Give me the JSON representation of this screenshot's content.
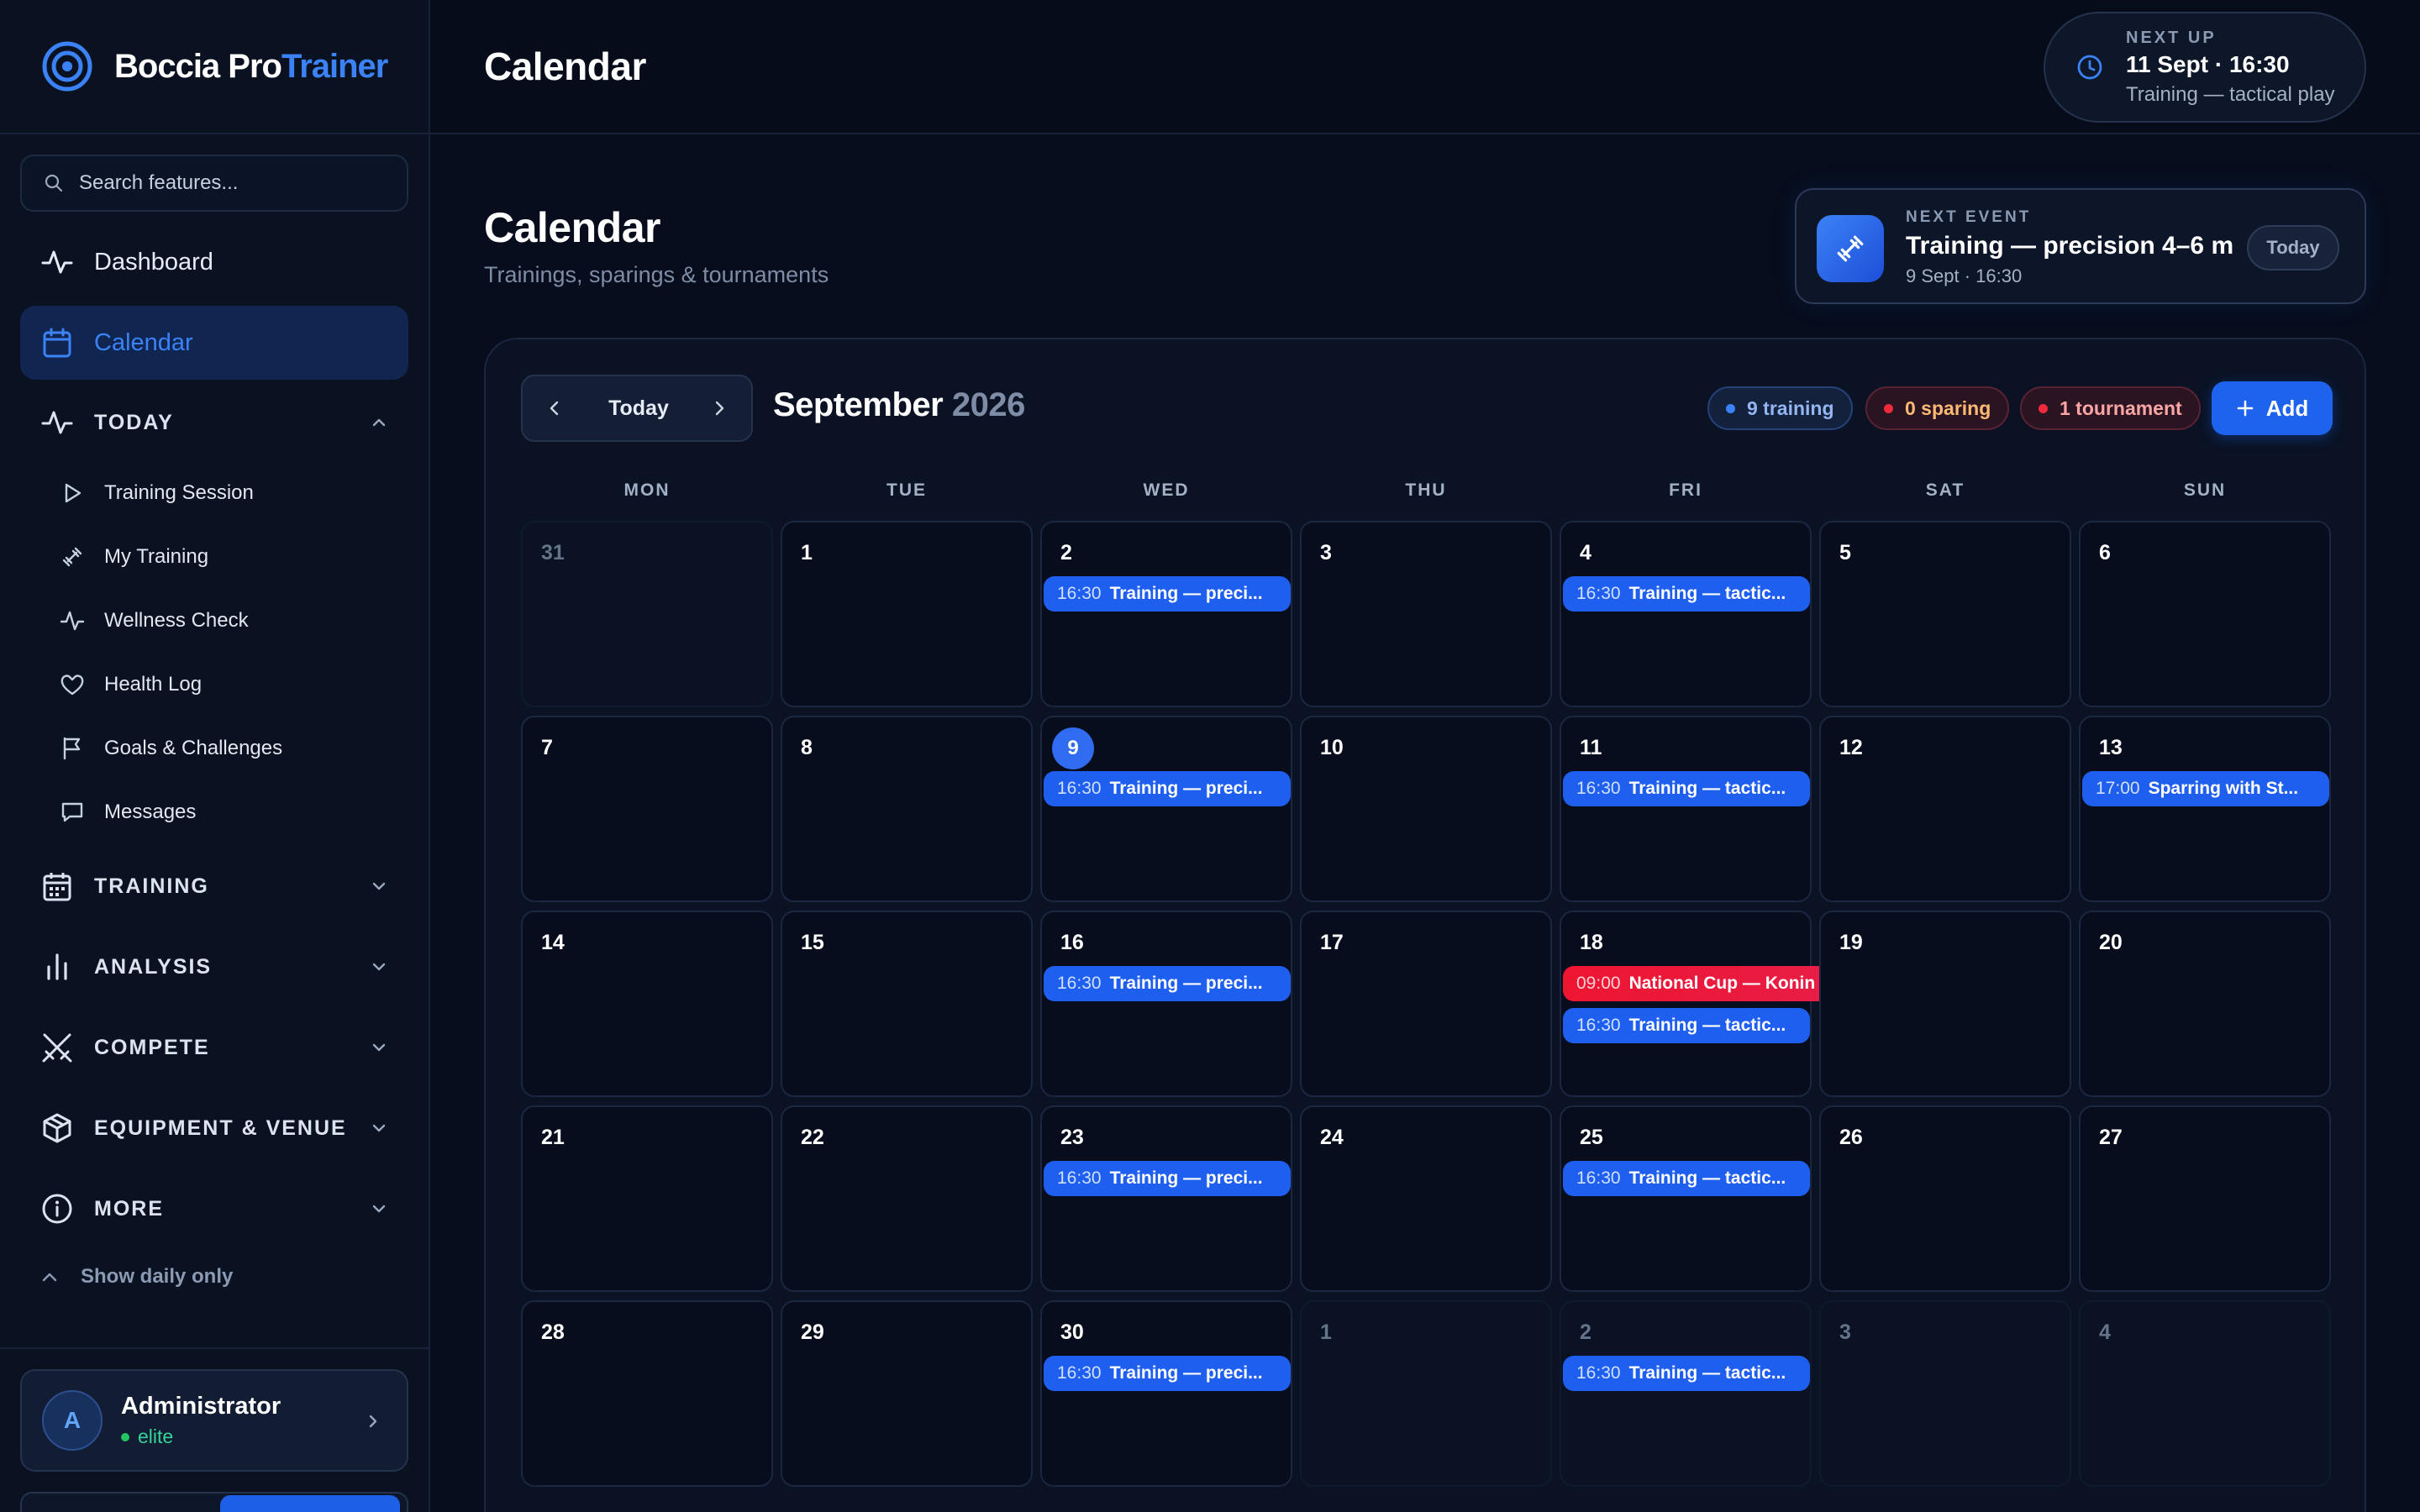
{
  "brand": {
    "name_main": "Boccia Pro",
    "name_accent": "Trainer"
  },
  "search": {
    "placeholder": "Search features..."
  },
  "nav": {
    "dashboard": "Dashboard",
    "calendar": "Calendar",
    "today_section": "TODAY",
    "today_items": [
      "Training Session",
      "My Training",
      "Wellness Check",
      "Health Log",
      "Goals & Challenges",
      "Messages"
    ],
    "sections": [
      "TRAINING",
      "ANALYSIS",
      "COMPETE",
      "EQUIPMENT & VENUE",
      "MORE"
    ],
    "show_daily": "Show daily only"
  },
  "user": {
    "initial": "A",
    "name": "Administrator",
    "level": "elite"
  },
  "topbar": {
    "title": "Calendar",
    "next_up_label": "NEXT UP",
    "next_up_time": "11 Sept · 16:30",
    "next_up_desc": "Training — tactical play"
  },
  "page": {
    "title": "Calendar",
    "subtitle": "Trainings, sparings & tournaments"
  },
  "next_event": {
    "label": "NEXT EVENT",
    "title": "Training — precision 4–6 m",
    "date": "9 Sept · 16:30",
    "badge": "Today"
  },
  "calendar": {
    "today_button": "Today",
    "month": "September",
    "year": "2026",
    "legend": {
      "training": "9 training",
      "sparring": "0 sparing",
      "tournament": "1 tournament"
    },
    "add_label": "Add",
    "weekdays": [
      "MON",
      "TUE",
      "WED",
      "THU",
      "FRI",
      "SAT",
      "SUN"
    ],
    "today_day": "9",
    "weeks": [
      [
        {
          "day": "31",
          "outside": true,
          "events": []
        },
        {
          "day": "1",
          "events": []
        },
        {
          "day": "2",
          "events": [
            {
              "time": "16:30",
              "title": "Training — preci...",
              "kind": "training"
            }
          ]
        },
        {
          "day": "3",
          "events": []
        },
        {
          "day": "4",
          "events": [
            {
              "time": "16:30",
              "title": "Training — tactic...",
              "kind": "training"
            }
          ]
        },
        {
          "day": "5",
          "events": []
        },
        {
          "day": "6",
          "events": []
        }
      ],
      [
        {
          "day": "7",
          "events": []
        },
        {
          "day": "8",
          "events": []
        },
        {
          "day": "9",
          "today": true,
          "events": [
            {
              "time": "16:30",
              "title": "Training — preci...",
              "kind": "training"
            }
          ]
        },
        {
          "day": "10",
          "events": []
        },
        {
          "day": "11",
          "events": [
            {
              "time": "16:30",
              "title": "Training — tactic...",
              "kind": "training"
            }
          ]
        },
        {
          "day": "12",
          "events": []
        },
        {
          "day": "13",
          "events": [
            {
              "time": "17:00",
              "title": "Sparring with St...",
              "kind": "training"
            }
          ]
        }
      ],
      [
        {
          "day": "14",
          "events": []
        },
        {
          "day": "15",
          "events": []
        },
        {
          "day": "16",
          "events": [
            {
              "time": "16:30",
              "title": "Training — preci...",
              "kind": "training"
            }
          ]
        },
        {
          "day": "17",
          "events": []
        },
        {
          "day": "18",
          "events": [
            {
              "time": "09:00",
              "title": "National Cup — Konin",
              "kind": "tournament",
              "span": 2
            },
            {
              "time": "16:30",
              "title": "Training — tactic...",
              "kind": "training"
            }
          ]
        },
        {
          "day": "19",
          "events": []
        },
        {
          "day": "20",
          "events": []
        }
      ],
      [
        {
          "day": "21",
          "events": []
        },
        {
          "day": "22",
          "events": []
        },
        {
          "day": "23",
          "events": [
            {
              "time": "16:30",
              "title": "Training — preci...",
              "kind": "training"
            }
          ]
        },
        {
          "day": "24",
          "events": []
        },
        {
          "day": "25",
          "events": [
            {
              "time": "16:30",
              "title": "Training — tactic...",
              "kind": "training"
            }
          ]
        },
        {
          "day": "26",
          "events": []
        },
        {
          "day": "27",
          "events": []
        }
      ],
      [
        {
          "day": "28",
          "events": []
        },
        {
          "day": "29",
          "events": []
        },
        {
          "day": "30",
          "events": [
            {
              "time": "16:30",
              "title": "Training — preci...",
              "kind": "training"
            }
          ]
        },
        {
          "day": "1",
          "outside": true,
          "events": []
        },
        {
          "day": "2",
          "outside": true,
          "events": [
            {
              "time": "16:30",
              "title": "Training — tactic...",
              "kind": "training"
            }
          ]
        },
        {
          "day": "3",
          "outside": true,
          "events": []
        },
        {
          "day": "4",
          "outside": true,
          "events": []
        }
      ]
    ]
  }
}
